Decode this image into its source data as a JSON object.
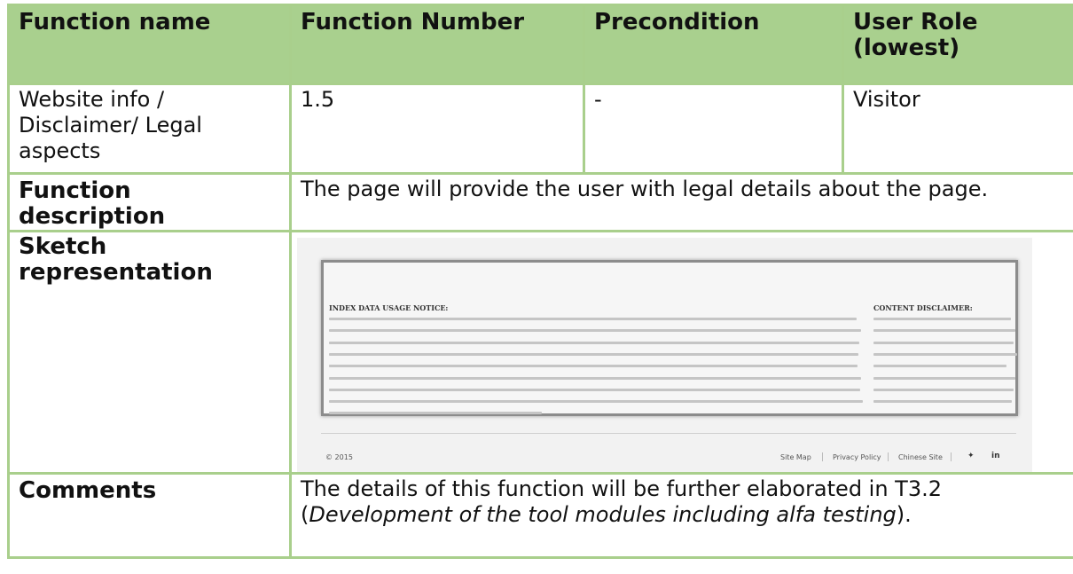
{
  "table": {
    "headers": [
      "Function name",
      "Function Number",
      "Precondition",
      "User Role (lowest)"
    ],
    "row": {
      "function_name": "Website info / Disclaimer/ Legal aspects",
      "function_number": "1.5",
      "precondition": "-",
      "user_role": "Visitor"
    },
    "description_label": "Function description",
    "description_text": "The page will provide the user with legal details about the page.",
    "sketch_label": "Sketch representation",
    "comments_label": "Comments",
    "comments_text_pre": "The details of this function will be further elaborated in T3.2 (",
    "comments_text_em": "Development of the tool modules including alfa testing",
    "comments_text_post": ")."
  },
  "sketch": {
    "notice_title": "INDEX DATA USAGE NOTICE:",
    "disclaimer_title": "CONTENT DISCLAIMER:",
    "copyright": "© 2015",
    "footer_links": [
      "Site Map",
      "Privacy Policy",
      "Chinese Site"
    ],
    "social_icons": [
      "twitter-icon",
      "linkedin-icon"
    ]
  }
}
